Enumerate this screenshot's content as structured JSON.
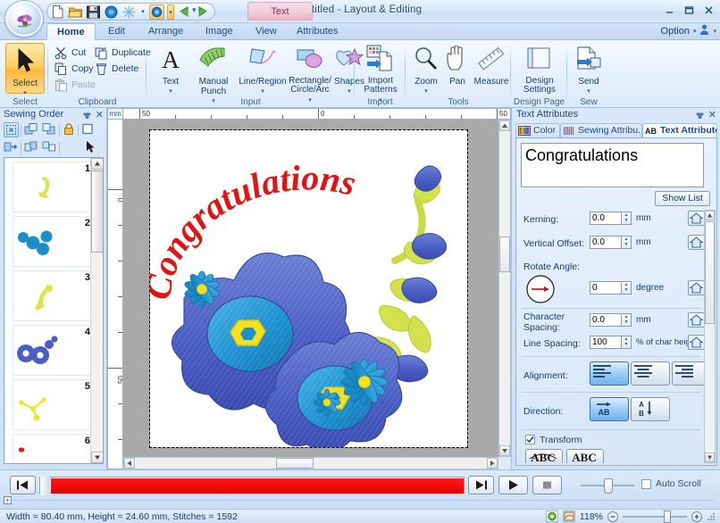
{
  "window": {
    "title": "Untitled - Layout & Editing",
    "minimize": "–",
    "maximize": "□",
    "close": "✕"
  },
  "quick_access": {
    "icons": [
      "new-file-icon",
      "open-folder-icon",
      "save-disk-icon",
      "blue-circle-icon",
      "snowflake-icon",
      "dropdown-caret-icon",
      "blue-circle-highlight-icon",
      "dropdown-caret-highlight-icon",
      "undo-green-arrow-icon",
      "redo-green-arrow-icon"
    ],
    "more": "customize-caret-icon"
  },
  "contextual_tab": {
    "label": "Text"
  },
  "tabs": [
    {
      "label": "Home",
      "active": true
    },
    {
      "label": "Edit",
      "active": false
    },
    {
      "label": "Arrange",
      "active": false
    },
    {
      "label": "Image",
      "active": false
    },
    {
      "label": "View",
      "active": false
    },
    {
      "label": "Attributes",
      "active": false
    }
  ],
  "option": {
    "label": "Option",
    "caret": "▾",
    "help_caret": "▾"
  },
  "ribbon": {
    "groups": [
      {
        "name": "Select",
        "label": "Select",
        "buttons": [
          {
            "label": "Select",
            "icon": "arrow-cursor-icon",
            "caret": "▾",
            "selected": true
          }
        ]
      },
      {
        "name": "Clipboard",
        "label": "Clipboard",
        "buttons": [
          {
            "label": "Cut",
            "icon": "scissors-icon",
            "disabled": false
          },
          {
            "label": "Copy",
            "icon": "copy-icon",
            "disabled": false
          },
          {
            "label": "Paste",
            "icon": "paste-icon",
            "disabled": true
          },
          {
            "label": "Duplicate",
            "icon": "duplicate-icon",
            "disabled": false
          },
          {
            "label": "Delete",
            "icon": "delete-trash-icon",
            "disabled": false
          }
        ]
      },
      {
        "name": "Input",
        "label": "Input",
        "buttons": [
          {
            "label": "Text",
            "icon": "text-a-icon",
            "caret": "▾"
          },
          {
            "label": "Manual Punch",
            "icon": "manual-punch-icon",
            "caret": "▾"
          },
          {
            "label": "Line/Region",
            "icon": "line-region-icon",
            "caret": "▾"
          },
          {
            "label": "Rectangle/ Circle/Arc",
            "icon": "rectangle-circle-arc-icon",
            "caret": "▾"
          },
          {
            "label": "Shapes",
            "icon": "shapes-icon",
            "caret": "▾"
          }
        ]
      },
      {
        "name": "Import",
        "label": "Import",
        "buttons": [
          {
            "label": "Import Patterns",
            "icon": "import-patterns-icon",
            "caret": "▾"
          }
        ]
      },
      {
        "name": "Tools",
        "label": "Tools",
        "buttons": [
          {
            "label": "Zoom",
            "icon": "magnifier-icon",
            "caret": "▾"
          },
          {
            "label": "Pan",
            "icon": "hand-pan-icon"
          },
          {
            "label": "Measure",
            "icon": "ruler-measure-icon"
          }
        ]
      },
      {
        "name": "Design Page",
        "label": "Design Page",
        "buttons": [
          {
            "label": "Design Settings",
            "icon": "design-settings-icon"
          }
        ]
      },
      {
        "name": "Sew",
        "label": "Sew",
        "buttons": [
          {
            "label": "Send",
            "icon": "send-sew-icon",
            "caret": "▾"
          }
        ]
      }
    ]
  },
  "sewing_order": {
    "title": "Sewing Order",
    "pin": "📌",
    "close": "✕",
    "toolbar_icons": [
      "select-all-objects-icon",
      "move-forward-icon",
      "move-backward-icon",
      "lock-icon",
      "frame-icon",
      "insert-object-icon",
      "group-icon",
      "ungroup-icon",
      "arrow-cursor-small-icon"
    ],
    "items": [
      {
        "number": "1",
        "thumb": "yellow-green-stem",
        "color": "#d8e34a"
      },
      {
        "number": "2",
        "thumb": "blue-flowers",
        "color": "#1f8ecb"
      },
      {
        "number": "3",
        "thumb": "yellow-green-leaf",
        "color": "#d8e34a"
      },
      {
        "number": "4",
        "thumb": "blue-petals",
        "color": "#4a5fc1"
      },
      {
        "number": "5",
        "thumb": "yellow-centers",
        "color": "#f5e02a"
      },
      {
        "number": "6",
        "thumb": "red-small-dot",
        "color": "#e11616"
      }
    ],
    "scroll_up": "▲",
    "scroll_down": "▼"
  },
  "canvas": {
    "unit": "mm",
    "ruler_h_labels": [
      "50",
      "0",
      "50"
    ],
    "ruler_v_labels": [
      "0",
      "50"
    ],
    "design_text": "Congratulations",
    "design_text_color": "#e01414",
    "flower_blue": "#4a5ec4",
    "flower_cyan": "#1b8fcf",
    "flower_yellow": "#f7e11d",
    "leaf_green": "#d3e14c",
    "scroll_up": "▲",
    "scroll_down": "▼",
    "scroll_left": "◀",
    "scroll_right": "▶"
  },
  "text_attributes": {
    "panel_title": "Text Attributes",
    "pin": "📌",
    "close": "✕",
    "tabs": [
      {
        "label": "Color",
        "icon": "color-palette-icon",
        "active": false
      },
      {
        "label": "Sewing Attribu...",
        "icon": "sewing-attributes-icon",
        "active": false
      },
      {
        "label": "Text Attributes",
        "icon": "ab-text-icon",
        "active": true
      }
    ],
    "text_value": "Congratulations",
    "show_list_label": "Show List",
    "fields": [
      {
        "label": "Kerning:",
        "value": "0.0",
        "unit": "mm",
        "home_icon": "reset-home-icon"
      },
      {
        "label": "Vertical Offset:",
        "value": "0.0",
        "unit": "mm",
        "home_icon": "reset-home-icon"
      },
      {
        "label": "Rotate Angle:",
        "value": "0",
        "unit": "degree",
        "home_icon": "reset-home-icon",
        "dial_icon": "rotate-dial-icon"
      },
      {
        "label": "Character Spacing:",
        "value": "0.0",
        "unit": "mm",
        "home_icon": "reset-home-icon"
      },
      {
        "label": "Line Spacing:",
        "value": "100",
        "unit": "% of char height",
        "home_icon": "reset-home-icon"
      }
    ],
    "alignment": {
      "label": "Alignment:",
      "options": [
        {
          "icon": "align-left-icon",
          "active": true
        },
        {
          "icon": "align-center-icon",
          "active": false
        },
        {
          "icon": "align-right-icon",
          "active": false
        }
      ]
    },
    "direction": {
      "label": "Direction:",
      "options": [
        {
          "icon": "direction-horizontal-ab-icon",
          "active": true
        },
        {
          "icon": "direction-vertical-ab-icon",
          "active": false
        }
      ]
    },
    "transform": {
      "label": "Transform",
      "checked": true,
      "shape_buttons": [
        "arc-up-abc-icon",
        "flat-abc-icon"
      ]
    },
    "scroll_up": "▲",
    "scroll_down": "▼"
  },
  "playback": {
    "first_button": "skip-to-start-icon",
    "last_button": "skip-to-end-icon",
    "play_button": "play-icon",
    "stop_button": "stop-icon",
    "progress_color": "#ee0000",
    "progress_percent": 100,
    "speed_slider_value": 50,
    "auto_scroll_label": "Auto Scroll",
    "auto_scroll_checked": false,
    "expander": "+"
  },
  "status_bar": {
    "text": "Width = 80.40 mm, Height = 24.60 mm, Stitches = 1592",
    "icons": [
      "realistic-preview-icon",
      "stitch-preview-icon"
    ],
    "zoom_level": "118%",
    "zoom_out": "–",
    "zoom_in": "+",
    "zoom_slider_value": 62,
    "grip": "resize-grip-icon"
  }
}
